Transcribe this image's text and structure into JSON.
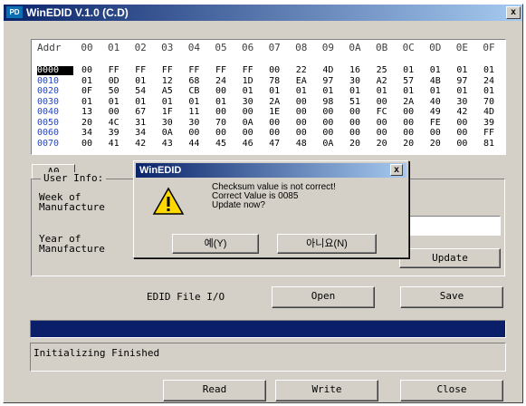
{
  "window": {
    "title": "WinEDID V.1.0 (C.D)",
    "close_glyph": "x",
    "icon_text": "PD"
  },
  "hex": {
    "columns": [
      "Addr",
      "00",
      "01",
      "02",
      "03",
      "04",
      "05",
      "06",
      "07",
      "08",
      "09",
      "0A",
      "0B",
      "0C",
      "0D",
      "0E",
      "0F"
    ],
    "rows": [
      {
        "addr": "0000",
        "cells": [
          "00",
          "FF",
          "FF",
          "FF",
          "FF",
          "FF",
          "FF",
          "00",
          "22",
          "4D",
          "16",
          "25",
          "01",
          "01",
          "01",
          "01"
        ]
      },
      {
        "addr": "0010",
        "cells": [
          "01",
          "0D",
          "01",
          "12",
          "68",
          "24",
          "1D",
          "78",
          "EA",
          "97",
          "30",
          "A2",
          "57",
          "4B",
          "97",
          "24"
        ]
      },
      {
        "addr": "0020",
        "cells": [
          "0F",
          "50",
          "54",
          "A5",
          "CB",
          "00",
          "01",
          "01",
          "01",
          "01",
          "01",
          "01",
          "01",
          "01",
          "01",
          "01"
        ]
      },
      {
        "addr": "0030",
        "cells": [
          "01",
          "01",
          "01",
          "01",
          "01",
          "01",
          "30",
          "2A",
          "00",
          "98",
          "51",
          "00",
          "2A",
          "40",
          "30",
          "70"
        ]
      },
      {
        "addr": "0040",
        "cells": [
          "13",
          "00",
          "67",
          "1F",
          "11",
          "00",
          "00",
          "1E",
          "00",
          "00",
          "00",
          "FC",
          "00",
          "49",
          "42",
          "4D"
        ]
      },
      {
        "addr": "0050",
        "cells": [
          "20",
          "4C",
          "31",
          "30",
          "30",
          "70",
          "0A",
          "00",
          "00",
          "00",
          "00",
          "00",
          "00",
          "FE",
          "00",
          "39"
        ]
      },
      {
        "addr": "0060",
        "cells": [
          "34",
          "39",
          "34",
          "0A",
          "00",
          "00",
          "00",
          "00",
          "00",
          "00",
          "00",
          "00",
          "00",
          "00",
          "00",
          "FF"
        ]
      },
      {
        "addr": "0070",
        "cells": [
          "00",
          "41",
          "42",
          "43",
          "44",
          "45",
          "46",
          "47",
          "48",
          "0A",
          "20",
          "20",
          "20",
          "20",
          "00",
          "81"
        ]
      }
    ],
    "selected_addr": "0000"
  },
  "tab": {
    "label": "A0"
  },
  "user_info": {
    "title": "User Info:",
    "week_label": "Week of\nManufacture",
    "year_label": "Year of\nManufacture",
    "update_label": "Update"
  },
  "file_io": {
    "label": "EDID File I/O",
    "open_label": "Open",
    "save_label": "Save"
  },
  "progress": {
    "value": 1.0,
    "color": "#0a1e6a"
  },
  "status": {
    "text": "Initializing Finished"
  },
  "footer": {
    "read_label": "Read",
    "write_label": "Write",
    "close_label": "Close"
  },
  "dialog": {
    "title": "WinEDID",
    "message": "Checksum value is not correct!\nCorrect Value is 0085\nUpdate now?",
    "yes_label": "예(Y)",
    "no_label": "아니요(N)",
    "icon": "warning-icon"
  }
}
